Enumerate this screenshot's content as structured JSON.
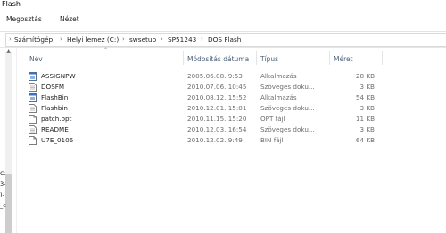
{
  "window": {
    "title": "Flash"
  },
  "ribbon": {
    "tabs": [
      "Megosztás",
      "Nézet"
    ]
  },
  "address": {
    "crumbs": [
      "Számítógép",
      "Helyi lemez (C:)",
      "swsetup",
      "SP51243",
      "DOS Flash"
    ]
  },
  "left_fragments": [
    "C:",
    "3-",
    ")-",
    "_c"
  ],
  "columns": {
    "name": "Név",
    "date": "Módosítás dátuma",
    "type": "Típus",
    "size": "Méret"
  },
  "files": [
    {
      "name": "ASSIGNPW",
      "date": "2005.06.08. 9:53",
      "type": "Alkalmazás",
      "size": "28 KB",
      "icon": "app-icon"
    },
    {
      "name": "DOSFM",
      "date": "2010.07.06. 10:45",
      "type": "Szöveges doku...",
      "size": "3 KB",
      "icon": "text-document-icon"
    },
    {
      "name": "FlashBin",
      "date": "2010.08.12. 15:52",
      "type": "Alkalmazás",
      "size": "54 KB",
      "icon": "app-icon"
    },
    {
      "name": "Flashbin",
      "date": "2010.12.01. 15:01",
      "type": "Szöveges doku...",
      "size": "3 KB",
      "icon": "text-document-icon"
    },
    {
      "name": "patch.opt",
      "date": "2010.11.15. 15:20",
      "type": "OPT fájl",
      "size": "11 KB",
      "icon": "file-icon"
    },
    {
      "name": "README",
      "date": "2010.12.03. 16:54",
      "type": "Szöveges doku...",
      "size": "3 KB",
      "icon": "text-document-icon"
    },
    {
      "name": "U7E_0106",
      "date": "2010.12.02. 9:49",
      "type": "BIN fájl",
      "size": "64 KB",
      "icon": "file-icon"
    }
  ]
}
